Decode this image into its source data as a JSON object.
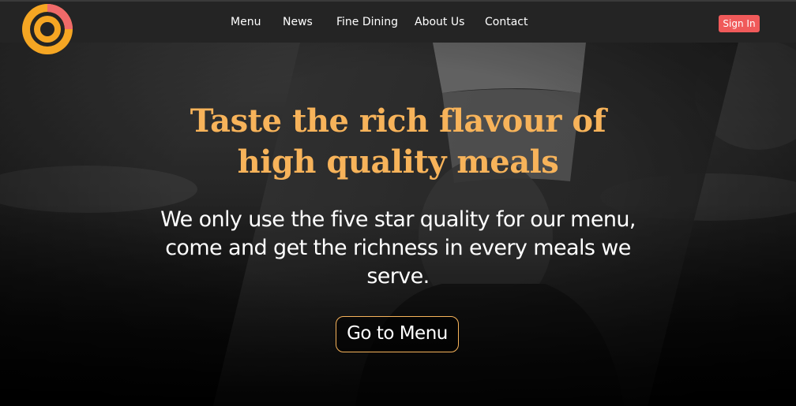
{
  "brand": {
    "logo_icon": "ring-logo-icon",
    "colors": {
      "accent": "#f7b35a",
      "logo_orange": "#f5a623",
      "logo_coral": "#f06a6a",
      "signin_bg": "#f05a5a",
      "nav_bg": "#242424"
    }
  },
  "nav": {
    "links": [
      {
        "label": "Menu"
      },
      {
        "label": "News"
      },
      {
        "label": "Fine Dining"
      },
      {
        "label": "About Us"
      },
      {
        "label": "Contact"
      }
    ],
    "signin_label": "Sign In"
  },
  "hero": {
    "title_line1": "Taste the rich flavour of",
    "title_line2": "high quality meals",
    "subtitle": "We only use the five star quality for our menu, come and get the richness in every meals we serve.",
    "button_label": "Go to Menu",
    "background_image": "chef-portrait-photo"
  }
}
